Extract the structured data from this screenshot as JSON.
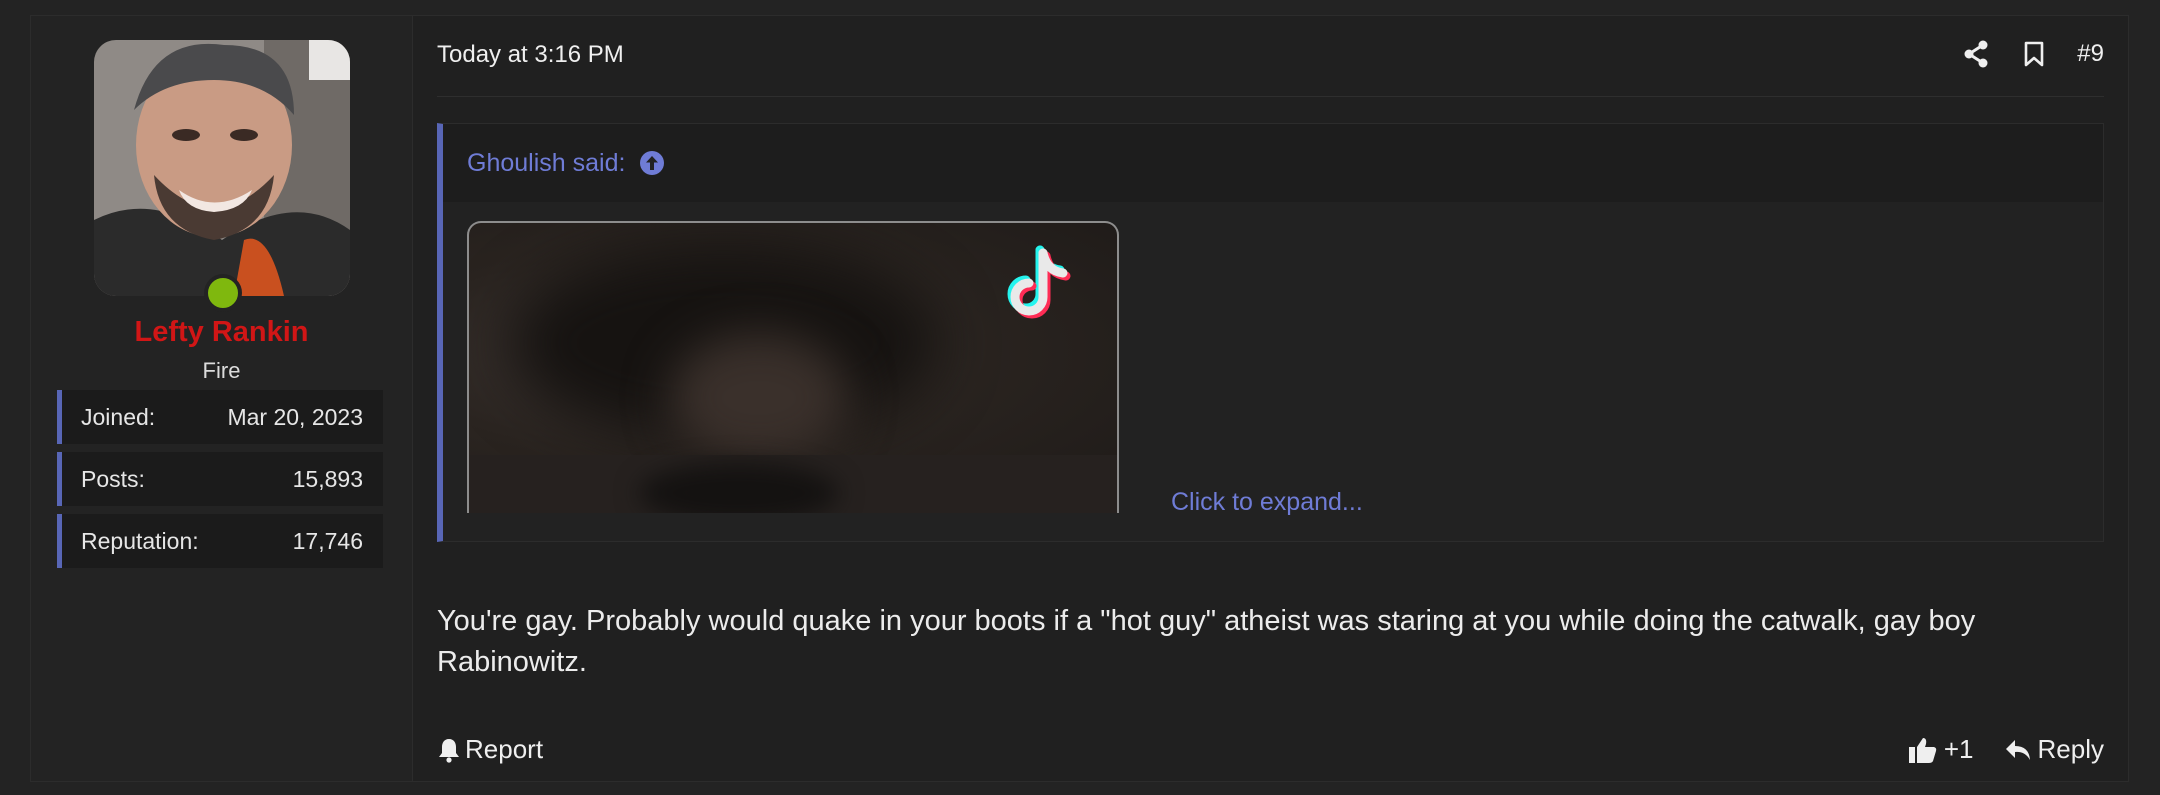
{
  "user": {
    "name": "Lefty Rankin",
    "title": "Fire",
    "stats": [
      {
        "label": "Joined:",
        "value": "Mar 20, 2023"
      },
      {
        "label": "Posts:",
        "value": "15,893"
      },
      {
        "label": "Reputation:",
        "value": "17,746"
      }
    ],
    "online_color": "#7fb80e",
    "name_color": "#d11616"
  },
  "post": {
    "date": "Today at 3:16 PM",
    "number": "#9",
    "share_icon": "share-icon",
    "bookmark_icon": "bookmark-icon",
    "quote": {
      "author_label": "Ghoulish said:",
      "jump_icon": "arrow-up-circle-icon",
      "media_icon": "tiktok-logo-icon",
      "expand_label": "Click to expand..."
    },
    "body": "You're gay. Probably would quake in your boots if a \"hot guy\" atheist was staring at you while doing the catwalk, gay boy Rabinowitz.",
    "actions": {
      "report": "Report",
      "reaction": "+1",
      "reply": "Reply"
    }
  },
  "accent_color": "#5866b6",
  "link_color": "#6f7cd6"
}
